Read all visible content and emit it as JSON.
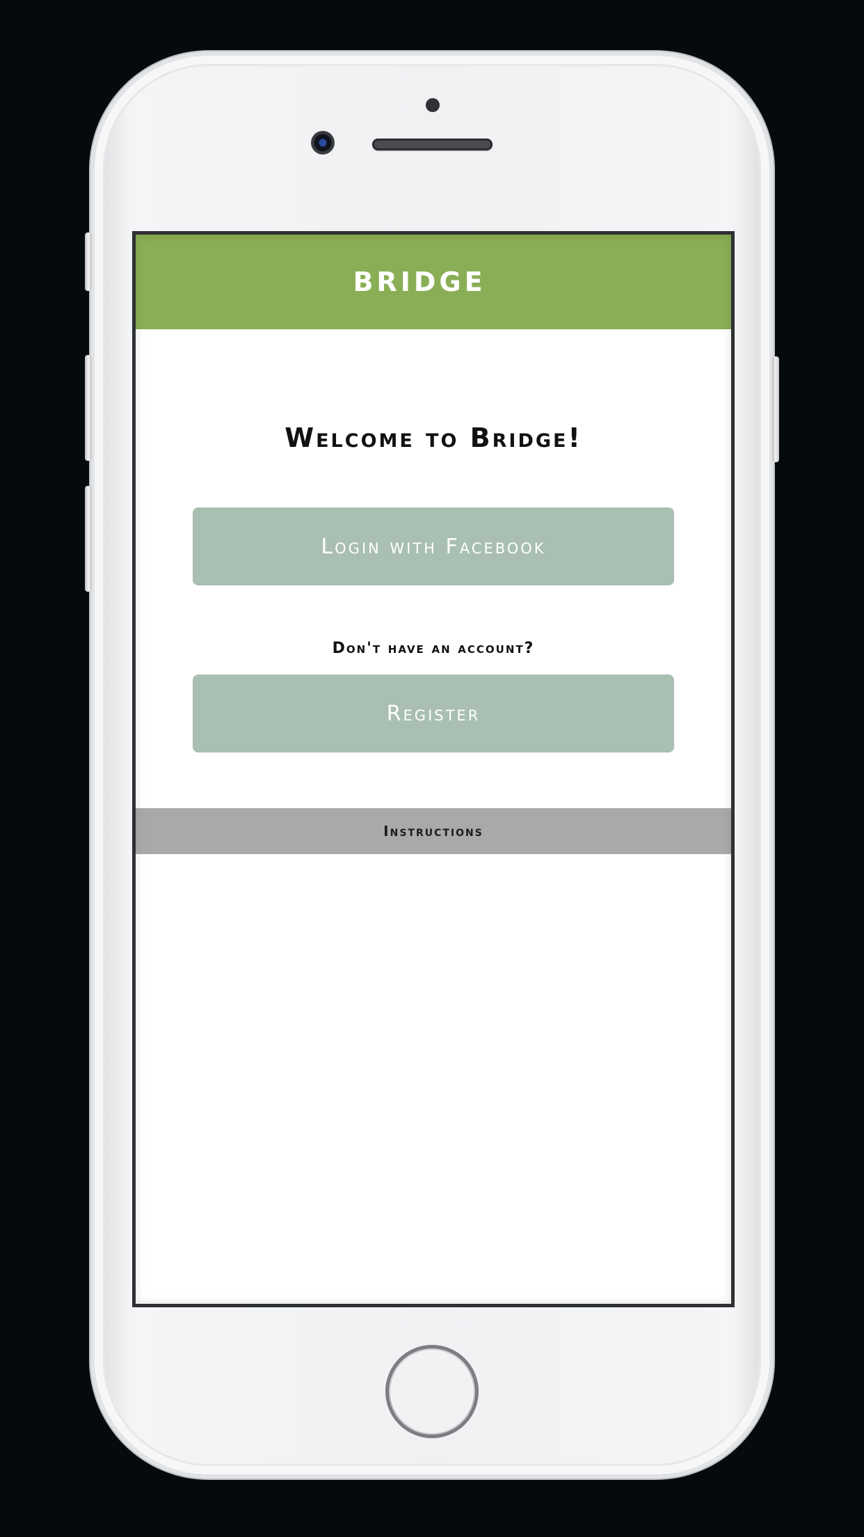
{
  "app": {
    "title": "BRIDGE"
  },
  "main": {
    "welcome": "Welcome to Bridge!",
    "login_facebook_label": "Login with Facebook",
    "no_account_text": "Don't have an account?",
    "register_label": "Register",
    "instructions_label": "Instructions"
  },
  "colors": {
    "navbar": "#8aae55",
    "button": "#a9bfb1",
    "instructions_bar": "#a9a9a9"
  },
  "icons": {
    "camera": "front-camera-icon",
    "speaker": "earpiece-speaker-icon",
    "home": "home-button-icon"
  }
}
